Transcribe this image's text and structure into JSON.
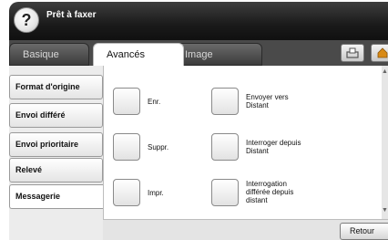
{
  "header": {
    "status_text": "Prêt à faxer",
    "help_icon": "question-mark-icon"
  },
  "tabs": [
    {
      "label": "Basique",
      "active": false
    },
    {
      "label": "Avancés",
      "active": true
    },
    {
      "label": "Image",
      "active": false
    }
  ],
  "toolbar": {
    "button1_icon": "tray-icon",
    "button2_icon": "home-icon"
  },
  "sidebar": {
    "items": [
      {
        "label": "Format d'origine",
        "active": false
      },
      {
        "label": "Envoi différé",
        "active": false
      },
      {
        "label": "Envoi prioritaire",
        "active": false
      },
      {
        "label": "Relevé",
        "active": false
      },
      {
        "label": "Messagerie",
        "active": true
      }
    ]
  },
  "main": {
    "options": [
      {
        "label": "Enr."
      },
      {
        "label": "Suppr."
      },
      {
        "label": "Impr."
      },
      {
        "label": "Envoyer vers\nDistant"
      },
      {
        "label": "Interroger depuis\nDistant"
      },
      {
        "label": "Interrogation\ndifférée depuis\ndistant"
      }
    ]
  },
  "footer": {
    "back_label": "Retour"
  }
}
